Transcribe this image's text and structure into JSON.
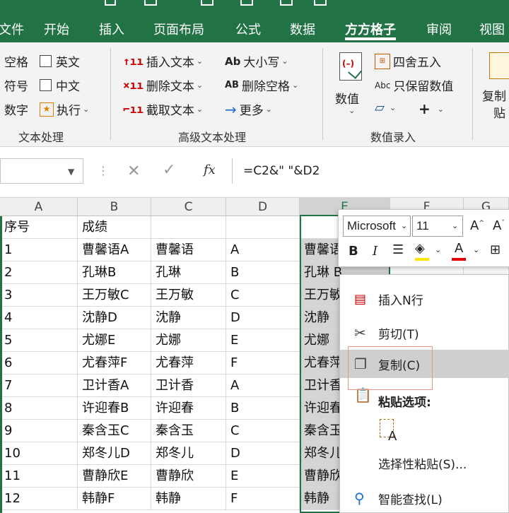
{
  "tabs": [
    "文件",
    "开始",
    "插入",
    "页面布局",
    "公式",
    "数据",
    "方方格子",
    "审阅",
    "视图"
  ],
  "active_tab": "方方格子",
  "ribbon": {
    "group1": {
      "left_items": [
        "空格",
        "符号",
        "数字"
      ],
      "checks": [
        "英文",
        "中文"
      ],
      "exec": "执行",
      "label": "文本处理"
    },
    "group2": {
      "insert_text": "插入文本",
      "delete_text": "删除文本",
      "extract_text": "截取文本",
      "case": "大小写",
      "case_icon": "Ab",
      "delete_space": "删除空格",
      "delete_space_icon": "AB",
      "more": "更多",
      "label": "高级文本处理"
    },
    "group3": {
      "value_btn": "数值",
      "round": "四舍五入",
      "keep_values": "只保留数值",
      "keep_icon": "Abc",
      "label": "数值录入"
    },
    "group4": {
      "copy_label_1": "复制",
      "copy_label_2": "贴"
    }
  },
  "formula_bar": {
    "fx": "fx",
    "formula": "=C2&\"  \"&D2"
  },
  "columns": [
    "A",
    "B",
    "C",
    "D",
    "E",
    "F",
    "G"
  ],
  "rows": [
    [
      "序号",
      "成绩",
      "",
      "",
      ""
    ],
    [
      "1",
      "曹馨语A",
      "曹馨语",
      "A",
      "曹馨语"
    ],
    [
      "2",
      "孔琳B",
      "孔琳",
      "B",
      "孔琳 B"
    ],
    [
      "3",
      "王万敏C",
      "王万敏",
      "C",
      "王万敏"
    ],
    [
      "4",
      "沈静D",
      "沈静",
      "D",
      "沈静"
    ],
    [
      "5",
      "尤娜E",
      "尤娜",
      "E",
      "尤娜"
    ],
    [
      "6",
      "尤春萍F",
      "尤春萍",
      "F",
      "尤春萍"
    ],
    [
      "7",
      "卫计香A",
      "卫计香",
      "A",
      "卫计香"
    ],
    [
      "8",
      "许迎春B",
      "许迎春",
      "B",
      "许迎春"
    ],
    [
      "9",
      "秦含玉C",
      "秦含玉",
      "C",
      "秦含玉"
    ],
    [
      "10",
      "郑冬儿D",
      "郑冬儿",
      "D",
      "郑冬儿"
    ],
    [
      "11",
      "曹静欣E",
      "曹静欣",
      "E",
      "曹静欣"
    ],
    [
      "12",
      "韩静F",
      "韩静",
      "F",
      "韩静"
    ]
  ],
  "mini_toolbar": {
    "font": "Microsoft",
    "size": "11",
    "grow": "A",
    "shrink": "A",
    "bold": "B",
    "italic": "I",
    "font_color_letter": "A"
  },
  "context_menu": {
    "insert_row": "插入N行",
    "cut": "剪切(T)",
    "copy": "复制(C)",
    "paste_header": "粘贴选项:",
    "paste_special": "选择性粘贴(S)...",
    "smart_lookup": "智能查找(L)"
  },
  "colors": {
    "excel_green": "#217346",
    "highlight_fill": "#FFE600",
    "font_color": "#E00000",
    "callout": "#E8938A"
  }
}
